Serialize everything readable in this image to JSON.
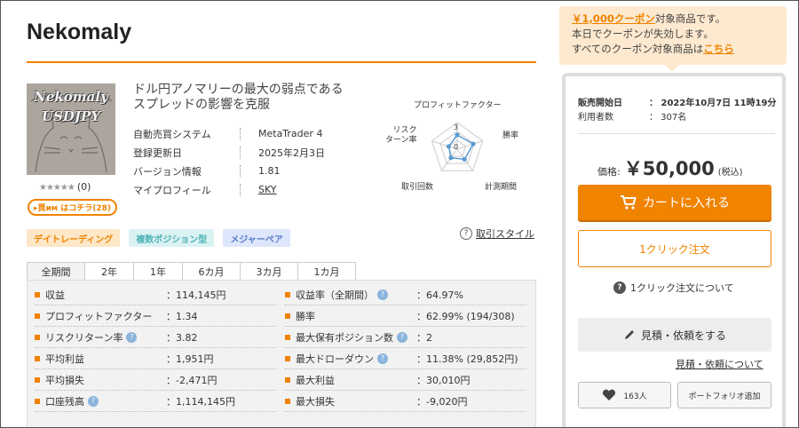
{
  "product": {
    "title": "Nekomaly",
    "thumb_line1": "Nekomaly",
    "thumb_line2": "USDJPY",
    "stars": "★★★★★",
    "review_count": "(0)",
    "buy_pill": "▸買им はコチラ(28)",
    "headline": "ドル円アノマリーの最大の弱点であるスプレッドの影響を克服"
  },
  "info": [
    {
      "label": "自動売買システム",
      "value": "MetaTrader 4"
    },
    {
      "label": "登録更新日",
      "value": "2025年2月3日"
    },
    {
      "label": "バージョン情報",
      "value": "1.81"
    },
    {
      "label": "マイプロフィール",
      "value": "SKY"
    }
  ],
  "radar": {
    "labels": {
      "pf": "プロフィットファクター",
      "win": "勝率",
      "period": "計測期間",
      "trades": "取引回数",
      "risk": "リスク\nターン率"
    },
    "scale_max": "3",
    "scale_zero": "0",
    "values": {
      "pf": 1.6,
      "win": 1.9,
      "period": 1.4,
      "trades": 1.2,
      "risk": 1.0
    }
  },
  "tags": [
    {
      "label": "デイトレーディング",
      "style": "o"
    },
    {
      "label": "複数ポジション型",
      "style": "c"
    },
    {
      "label": "メジャーペア",
      "style": "b"
    }
  ],
  "style_link": "取引スタイル",
  "tabs": [
    "全期間",
    "2年",
    "1年",
    "6カ月",
    "3カ月",
    "1カ月"
  ],
  "stats_left": [
    {
      "label": "収益",
      "value": "：114,145円",
      "q": false
    },
    {
      "label": "プロフィットファクター",
      "value": "：1.34",
      "q": false
    },
    {
      "label": "リスクリターン率",
      "value": "：3.82",
      "q": true
    },
    {
      "label": "平均利益",
      "value": "：1,951円",
      "q": false
    },
    {
      "label": "平均損失",
      "value": "：-2,471円",
      "q": false
    },
    {
      "label": "口座残高",
      "value": "：1,114,145円",
      "q": true
    }
  ],
  "stats_right": [
    {
      "label": "収益率（全期間）",
      "value": "：64.97%",
      "q": true
    },
    {
      "label": "勝率",
      "value": "：62.99% (194/308)",
      "q": false
    },
    {
      "label": "最大保有ポジション数",
      "value": "：2",
      "q": true
    },
    {
      "label": "最大ドローダウン",
      "value": "：11.38% (29,852円)",
      "q": true
    },
    {
      "label": "最大利益",
      "value": "：30,010円",
      "q": false
    },
    {
      "label": "最大損失",
      "value": "：-9,020円",
      "q": false
    }
  ],
  "coupon": {
    "amount": "￥1,000クーポン",
    "line1_rest": "対象商品です。",
    "line2": "本日でクーポンが失効します。",
    "line3": "すべてのクーポン対象商品は",
    "link": "こちら"
  },
  "sidebar": {
    "release_label": "販売開始日",
    "release_value": "：  2022年10月7日 11時19分",
    "users_label": "利用者数",
    "users_value": "：  307名",
    "price_label": "価格:",
    "price_value": "￥50,000",
    "tax": "(税込)",
    "cart": "カートに入れる",
    "oneclick": "1クリック注文",
    "oneclick_about": "1クリック注文について",
    "quote": "見積・依頼をする",
    "quote_about": "見積・依頼について",
    "likes": "163人",
    "portfolio": "ポートフォリオ追加"
  },
  "colors": {
    "accent": "#f08300",
    "tag_cyan": "#4eb1b6",
    "tag_blue": "#5a7ec9",
    "radar": "#5b9bd5"
  }
}
